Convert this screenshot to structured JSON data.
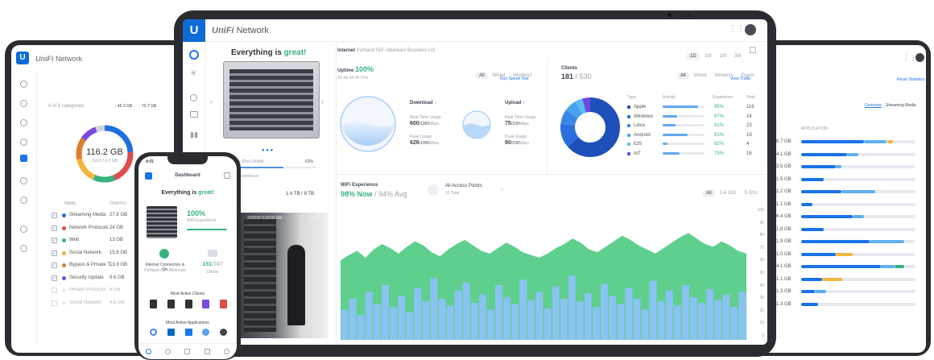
{
  "app_name": "Network",
  "brand": "UniFi",
  "colors": {
    "accent": "#1a73e8",
    "good": "#36b37e",
    "chart_green": "#5fcf8e",
    "chart_blue": "#8ac3f2"
  },
  "main": {
    "status_prefix": "Everything is ",
    "status_word": "great!",
    "internet_label": "Internet",
    "isp": "Portland ISP: Allstream Business US",
    "range_tabs": [
      "1D",
      "1W",
      "1M",
      "3M"
    ],
    "uptime_label": "Uptime",
    "uptime_value": "100%",
    "uptime_since": "2d 3w 4d 3h 27m",
    "filters": [
      "All",
      "Wired",
      "Wireless"
    ],
    "speed_test": "Run Speed Test",
    "download_label": "Download",
    "upload_label": "Upload",
    "rt_usage_label": "Real-Time Usage",
    "peak_usage_label": "Peak Usage",
    "download_rt": "600",
    "download_rt_unit": "/1000",
    "download_peak": "626",
    "download_peak_unit": "/1000",
    "upload_rt": "75",
    "upload_rt_unit": "/100",
    "upload_peak": "80",
    "upload_peak_unit": "/100",
    "unit_mbps": "Mbps",
    "clients_label": "Clients",
    "clients_value": "181",
    "clients_total": "/ 530",
    "clients_filters": [
      "All",
      "Wired",
      "Wireless",
      "Guest"
    ],
    "view_traffic": "View Traffic",
    "client_table_headers": [
      "Type",
      "Activity",
      "Experience",
      "Total"
    ],
    "client_rows": [
      {
        "type": "Apple",
        "exp": "95%",
        "total": "116",
        "activity": 0.85,
        "color": "#1f4fb8"
      },
      {
        "type": "Windows",
        "exp": "97%",
        "total": "24",
        "activity": 0.35,
        "color": "#2a6fe0"
      },
      {
        "type": "Linux",
        "exp": "91%",
        "total": "23",
        "activity": 0.3,
        "color": "#3a86e8"
      },
      {
        "type": "Android",
        "exp": "91%",
        "total": "19",
        "activity": 0.6,
        "color": "#4aa2ef"
      },
      {
        "type": "iOS",
        "exp": "82%",
        "total": "4",
        "activity": 0.12,
        "color": "#59bdf3"
      },
      {
        "type": "IoT",
        "exp": "75%",
        "total": "16",
        "activity": 0.4,
        "color": "#6b4ae0"
      }
    ],
    "wifi_label": "WiFi Experience",
    "wifi_now": "98% Now",
    "wifi_avg": "/ 94% Avg",
    "ap_label": "All Access Points",
    "ap_total": "12 Total",
    "band_filters": [
      "All",
      "2.4 Ghz",
      "5 Ghz"
    ],
    "right_axis": [
      "100",
      "90",
      "80",
      "70",
      "60",
      "50",
      "40",
      "30",
      "20",
      "10",
      "0"
    ],
    "uplink": "Uplink (Port 24/Intl)",
    "uplink_pct": "62%",
    "wifi_caption": "WiFi Experience",
    "storage": "1.4 TB / 8 TB",
    "camera_ts": "2/25/20 5:23:03 AM",
    "camera_temp": "141 °F"
  },
  "left": {
    "traffic_title": "4 of 8 categories",
    "down": "45.3 GB",
    "up": "70.7 GB",
    "total": "116.2 GB",
    "sub": "116.2 / 0.2 GB",
    "headers": [
      "NAME",
      "TRAFFIC"
    ],
    "rows": [
      {
        "name": "Streaming Media",
        "val": "27.6 GB",
        "color": "#1f6fe0",
        "checked": true
      },
      {
        "name": "Network Protocols",
        "val": "24 GB",
        "color": "#e04b4b",
        "checked": true
      },
      {
        "name": "Web",
        "val": "13 GB",
        "color": "#36b37e",
        "checked": true
      },
      {
        "name": "Social Network",
        "val": "15.6 GB",
        "color": "#f2b63d",
        "checked": true
      },
      {
        "name": "Bypass & Private T...",
        "val": "13.9 GB",
        "color": "#e07b2b",
        "checked": true
      },
      {
        "name": "Security Update",
        "val": "9.6 GB",
        "color": "#7a4ae0",
        "checked": true
      },
      {
        "name": "Private Protocols",
        "val": "6 GB",
        "color": "#cfd3d9",
        "checked": false
      },
      {
        "name": "Social Network",
        "val": "4.6 GB",
        "color": "#cfd3d9",
        "checked": false
      }
    ]
  },
  "phone": {
    "time": "4:01",
    "title": "Dashboard",
    "status_prefix": "Everything is ",
    "status_word": "great!",
    "exp_value": "100%",
    "exp_label": "WiFi Experience",
    "internet_label": "Internet Connection is On",
    "isp": "Portland ISP: Allstream",
    "clients_value": "151",
    "clients_total": "/247",
    "clients_label": "Clients",
    "most_active_clients": "Most Active Clients",
    "most_active_apps": "Most Active Applications"
  },
  "right": {
    "reset": "Reset Statistics",
    "tabs": [
      "Overview",
      "Streaming Media"
    ],
    "headers": [
      "IC",
      "APPLICATION"
    ],
    "rows": [
      "6.7 GB",
      "4.1 GB",
      "3.5 GB",
      "1.5 GB",
      "1.2 GB",
      "1.1 GB",
      "6.4 GB",
      "1.8 GB",
      "1.9 GB",
      "1.0 GB",
      "4.1 GB",
      "1.1 GB",
      "1.3 GB",
      "1.3 GB"
    ]
  },
  "chart_data": {
    "type": "area",
    "title": "WiFi Experience",
    "y_ticks": [
      100,
      90,
      80,
      70,
      60,
      50,
      40,
      30,
      20,
      10,
      0
    ],
    "ylim": [
      0,
      100
    ],
    "series": [
      {
        "name": "Experience",
        "values": [
          58,
          62,
          65,
          60,
          66,
          70,
          67,
          63,
          68,
          72,
          69,
          64,
          61,
          66,
          70,
          73,
          69,
          65,
          63,
          67,
          71,
          68,
          64,
          62,
          60,
          63,
          67,
          70,
          74,
          71,
          66,
          64,
          68,
          72,
          76,
          73,
          69,
          66,
          63,
          67,
          71,
          75,
          78,
          74,
          70,
          68,
          72,
          69,
          65,
          63
        ]
      },
      {
        "name": "Usage",
        "values": [
          22,
          30,
          18,
          35,
          26,
          40,
          24,
          32,
          20,
          38,
          28,
          45,
          30,
          25,
          36,
          42,
          27,
          33,
          22,
          40,
          31,
          26,
          44,
          29,
          35,
          23,
          39,
          30,
          47,
          28,
          34,
          24,
          41,
          32,
          26,
          38,
          30,
          22,
          43,
          28,
          36,
          25,
          40,
          31,
          27,
          37,
          29,
          33,
          24,
          35
        ]
      }
    ]
  }
}
